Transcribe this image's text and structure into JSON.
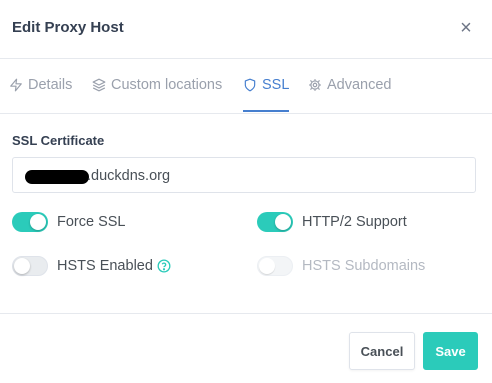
{
  "modal": {
    "title": "Edit Proxy Host",
    "close_glyph": "×"
  },
  "tabs": [
    {
      "label": "Details",
      "icon": "zap-icon",
      "active": false
    },
    {
      "label": "Custom locations",
      "icon": "layers-icon",
      "active": false
    },
    {
      "label": "SSL",
      "icon": "shield-icon",
      "active": true
    },
    {
      "label": "Advanced",
      "icon": "gear-icon",
      "active": false
    }
  ],
  "ssl": {
    "section_label": "SSL Certificate",
    "certificate_value": ".duckdns.org",
    "force_ssl": {
      "label": "Force SSL",
      "enabled": true
    },
    "http2": {
      "label": "HTTP/2 Support",
      "enabled": true
    },
    "hsts": {
      "label": "HSTS Enabled",
      "enabled": false
    },
    "hsts_subdomains": {
      "label": "HSTS Subdomains",
      "enabled": false,
      "disabled": true
    }
  },
  "footer": {
    "cancel_label": "Cancel",
    "save_label": "Save"
  },
  "colors": {
    "accent_teal": "#2bcbba",
    "active_tab_blue": "#467fcf",
    "heading": "#354052"
  }
}
